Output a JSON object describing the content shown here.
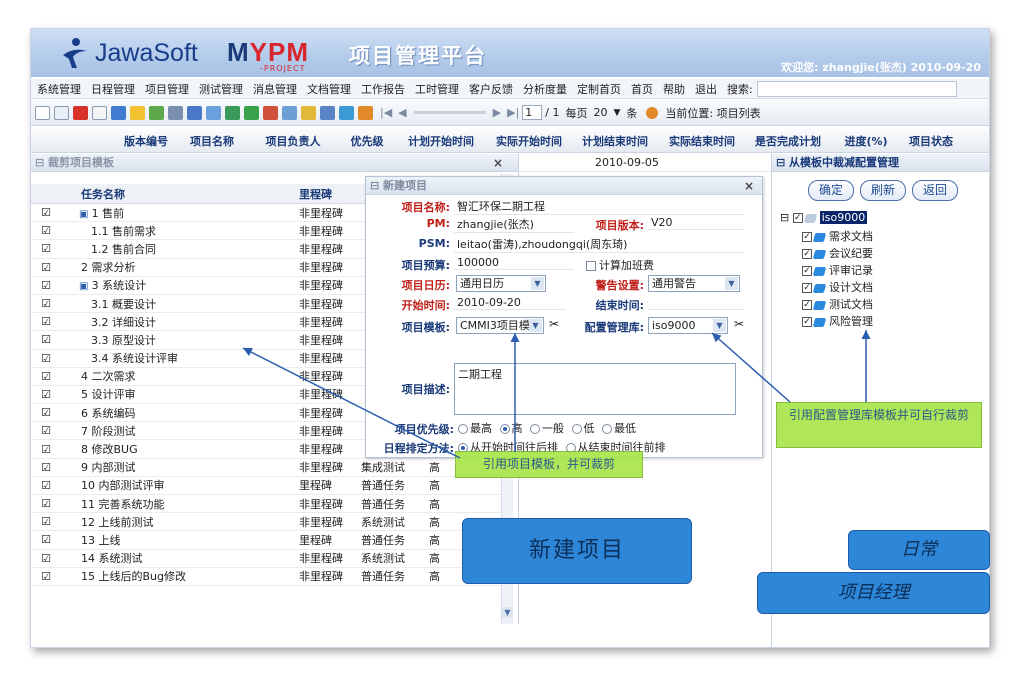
{
  "header": {
    "brand": "JawaSoft",
    "brand2_m": "M",
    "brand2_ypm": "YPM",
    "brand2_sub": "-PROJECT",
    "title": "项目管理平台",
    "welcome": "欢迎您: zhangjie(张杰)   2010-09-20"
  },
  "menu": [
    "系统管理",
    "日程管理",
    "项目管理",
    "测试管理",
    "消息管理",
    "文档管理",
    "工作报告",
    "工时管理",
    "客户反馈",
    "分析度量",
    "定制首页",
    "首页",
    "帮助",
    "退出"
  ],
  "search_label": "搜索:",
  "toolbar": {
    "page_value": "1",
    "page_total": "/ 1",
    "per_page_label": "每页",
    "per_page": "20",
    "per_page_unit": "条",
    "location": "当前位置: 项目列表"
  },
  "grid_headers": [
    "版本编号",
    "项目名称",
    "项目负责人",
    "优先级",
    "计划开始时间",
    "实际开始时间",
    "计划结束时间",
    "实际结束时间",
    "是否完成计划",
    "进度(%)",
    "项目状态"
  ],
  "grid_first_row_date": "2010-09-05",
  "template_panel": {
    "title": "裁剪项目模板",
    "close": "×",
    "col_task": "任务名称",
    "col_milestone": "里程碑",
    "rows": [
      {
        "name": "1 售前",
        "ms": "非里程碑",
        "type": "",
        "pri": "",
        "group": true
      },
      {
        "name": "1.1 售前需求",
        "ms": "非里程碑",
        "type": "",
        "pri": ""
      },
      {
        "name": "1.2 售前合同",
        "ms": "非里程碑",
        "type": "",
        "pri": ""
      },
      {
        "name": "2 需求分析",
        "ms": "非里程碑",
        "type": "",
        "pri": ""
      },
      {
        "name": "3 系统设计",
        "ms": "非里程碑",
        "type": "",
        "pri": "",
        "group": true
      },
      {
        "name": "3.1 概要设计",
        "ms": "非里程碑",
        "type": "",
        "pri": ""
      },
      {
        "name": "3.2 详细设计",
        "ms": "非里程碑",
        "type": "",
        "pri": ""
      },
      {
        "name": "3.3 原型设计",
        "ms": "非里程碑",
        "type": "",
        "pri": ""
      },
      {
        "name": "3.4 系统设计评审",
        "ms": "非里程碑",
        "type": "",
        "pri": ""
      },
      {
        "name": "4 二次需求",
        "ms": "非里程碑",
        "type": "",
        "pri": ""
      },
      {
        "name": "5 设计评审",
        "ms": "非里程碑",
        "type": "",
        "pri": ""
      },
      {
        "name": "6 系统编码",
        "ms": "非里程碑",
        "type": "",
        "pri": ""
      },
      {
        "name": "7 阶段测试",
        "ms": "非里程碑",
        "type": "",
        "pri": ""
      },
      {
        "name": "8 修改BUG",
        "ms": "非里程碑",
        "type": "",
        "pri": ""
      },
      {
        "name": "9 内部测试",
        "ms": "非里程碑",
        "type": "集成测试",
        "pri": "高"
      },
      {
        "name": "10 内部测试评审",
        "ms": "里程碑",
        "type": "普通任务",
        "pri": "高"
      },
      {
        "name": "11 完善系统功能",
        "ms": "非里程碑",
        "type": "普通任务",
        "pri": "高"
      },
      {
        "name": "12 上线前测试",
        "ms": "非里程碑",
        "type": "系统测试",
        "pri": "高"
      },
      {
        "name": "13 上线",
        "ms": "里程碑",
        "type": "普通任务",
        "pri": "高"
      },
      {
        "name": "14 系统测试",
        "ms": "非里程碑",
        "type": "系统测试",
        "pri": "高"
      },
      {
        "name": "15 上线后的Bug修改",
        "ms": "非里程碑",
        "type": "普通任务",
        "pri": "高"
      }
    ]
  },
  "new_project": {
    "title": "新建项目",
    "close": "×",
    "name_label": "项目名称:",
    "name": "智汇环保二期工程",
    "pm_label": "PM:",
    "pm": "zhangjie(张杰)",
    "version_label": "项目版本:",
    "version": "V20",
    "psm_label": "PSM:",
    "psm": "leitao(雷涛),zhoudongqi(周东琦)",
    "budget_label": "项目预算:",
    "budget": "100000",
    "overtime": "计算加班费",
    "calendar_label": "项目日历:",
    "calendar": "通用日历",
    "alert_label": "警告设置:",
    "alert": "通用警告",
    "start_label": "开始时间:",
    "start": "2010-09-20",
    "end_label": "结束时间:",
    "template_label": "项目模板:",
    "template": "CMMI3项目模",
    "repo_label": "配置管理库:",
    "repo": "iso9000",
    "desc_label": "项目描述:",
    "desc": "二期工程",
    "priority_label": "项目优先级:",
    "priorities": [
      "最高",
      "高",
      "一般",
      "低",
      "最低"
    ],
    "schedule_label": "日程排定方法:",
    "schedule_opts": [
      "从开始时间往后排",
      "从结束时间往前排"
    ]
  },
  "right_panel": {
    "title": "从模板中裁减配置管理",
    "buttons": [
      "确定",
      "刷新",
      "返回"
    ],
    "root": "iso9000",
    "items": [
      "需求文档",
      "会议纪要",
      "评审记录",
      "设计文档",
      "测试文档",
      "风险管理"
    ]
  },
  "callouts": {
    "template": "引用项目模板，并可裁剪",
    "repo": "引用配置管理库模板并可自行裁剪",
    "new_project": "新建项目",
    "daily": "日常",
    "pm": "项目经理"
  }
}
